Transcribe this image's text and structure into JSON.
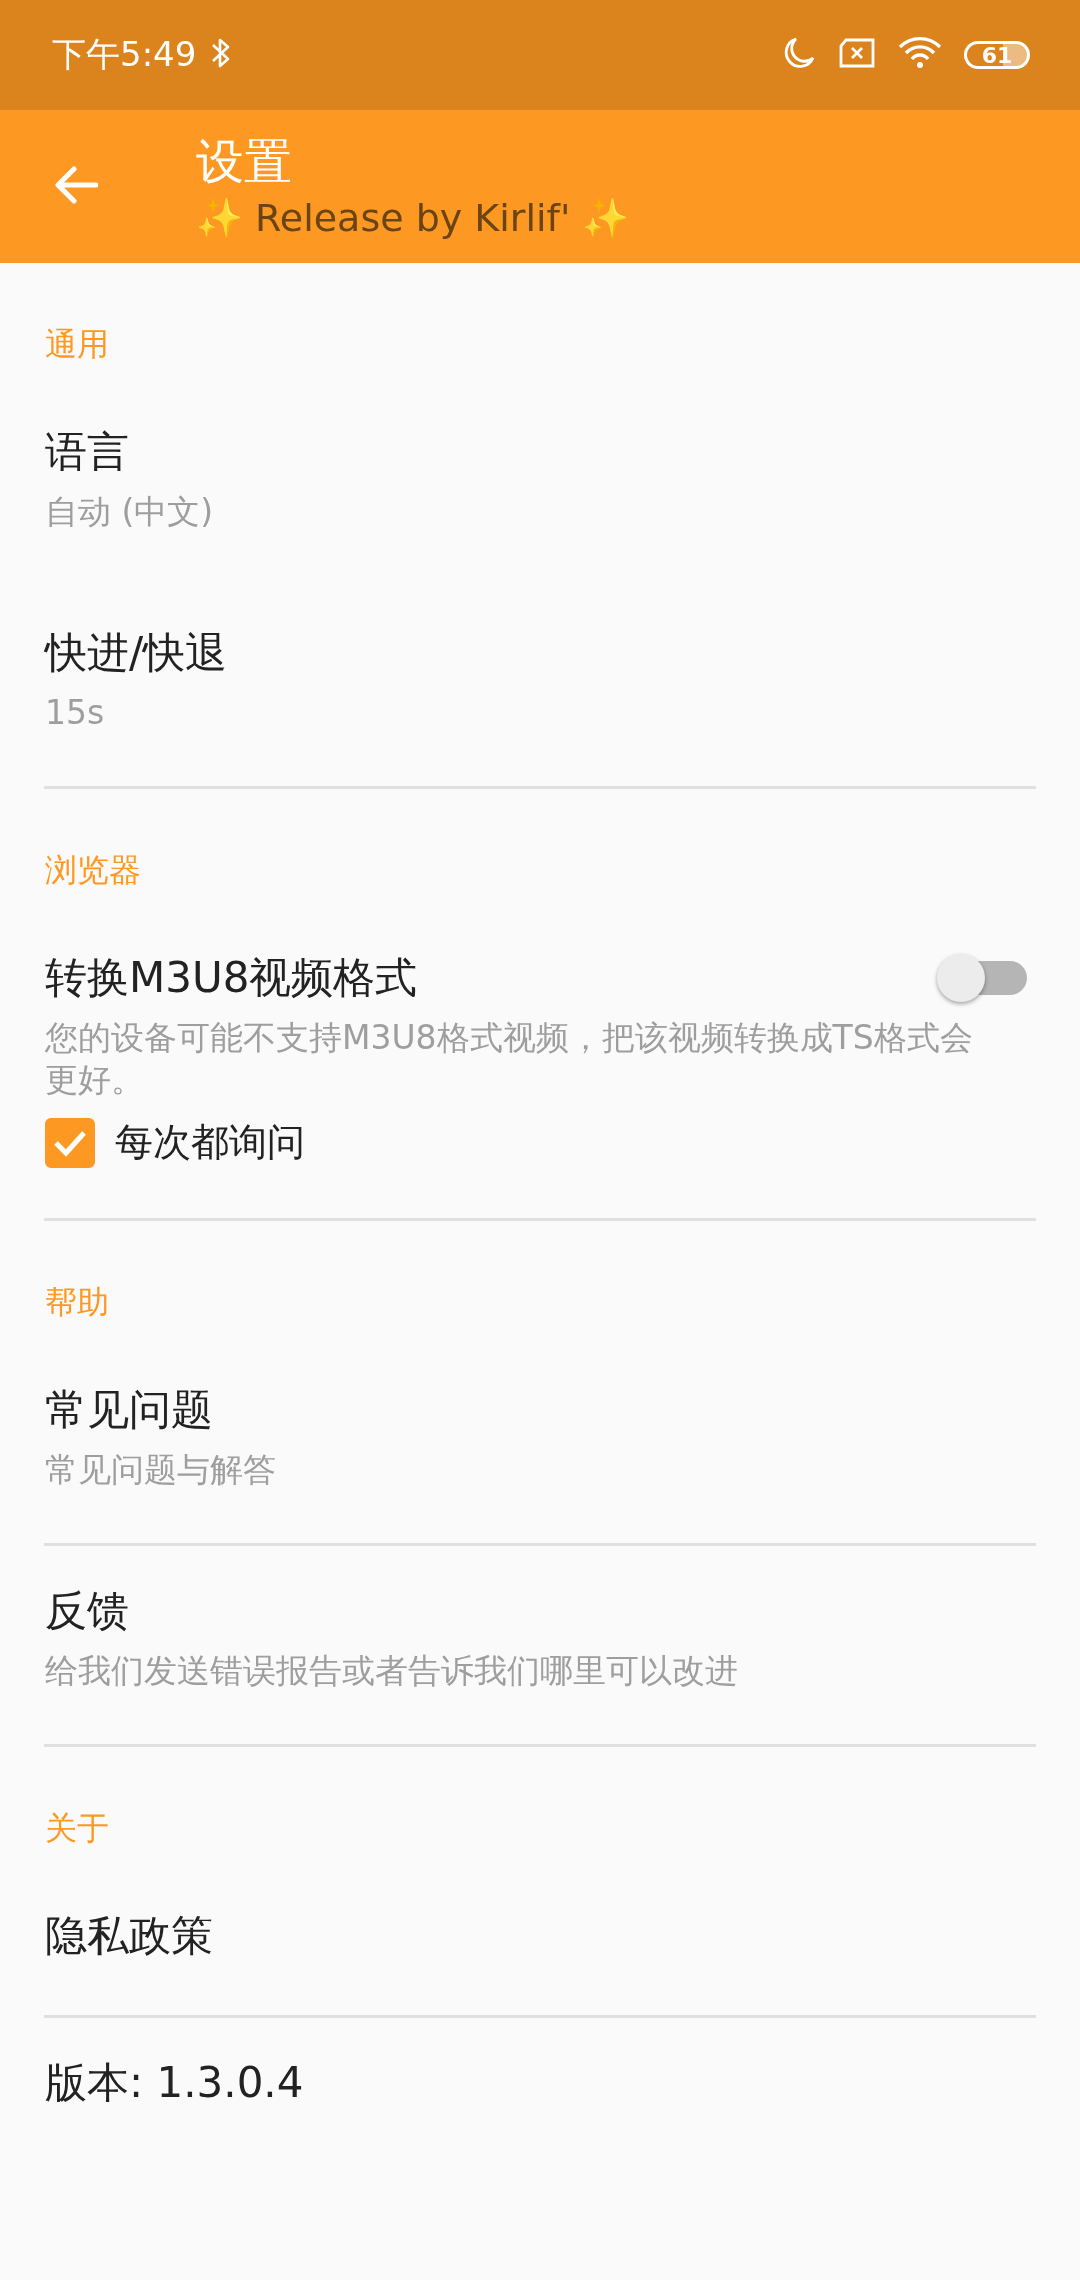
{
  "status_bar": {
    "time": "下午5:49",
    "battery": "61"
  },
  "app_bar": {
    "title": "设置",
    "subtitle": "✨ Release by Kirlif' ✨"
  },
  "sections": [
    {
      "label": "通用",
      "items": [
        {
          "kind": "text",
          "title": "语言",
          "subtitle": "自动 (中文)",
          "divider": false
        },
        {
          "kind": "text",
          "title": "快进/快退",
          "subtitle": "15s",
          "divider": true
        }
      ]
    },
    {
      "label": "浏览器",
      "items": [
        {
          "kind": "switch",
          "title": "转换M3U8视频格式",
          "on": false,
          "description": "您的设备可能不支持M3U8格式视频，把该视频转换成TS格式会更好。",
          "checkbox": {
            "label": "每次都询问",
            "checked": true
          },
          "divider": true
        }
      ]
    },
    {
      "label": "帮助",
      "items": [
        {
          "kind": "text",
          "title": "常见问题",
          "subtitle": "常见问题与解答",
          "divider": true
        },
        {
          "kind": "text",
          "title": "反馈",
          "subtitle": "给我们发送错误报告或者告诉我们哪里可以改进",
          "divider": true
        }
      ]
    },
    {
      "label": "关于",
      "items": [
        {
          "kind": "text",
          "title": "隐私政策",
          "divider": true
        },
        {
          "kind": "text",
          "title": "版本: 1.3.0.4",
          "divider": false
        }
      ]
    }
  ]
}
